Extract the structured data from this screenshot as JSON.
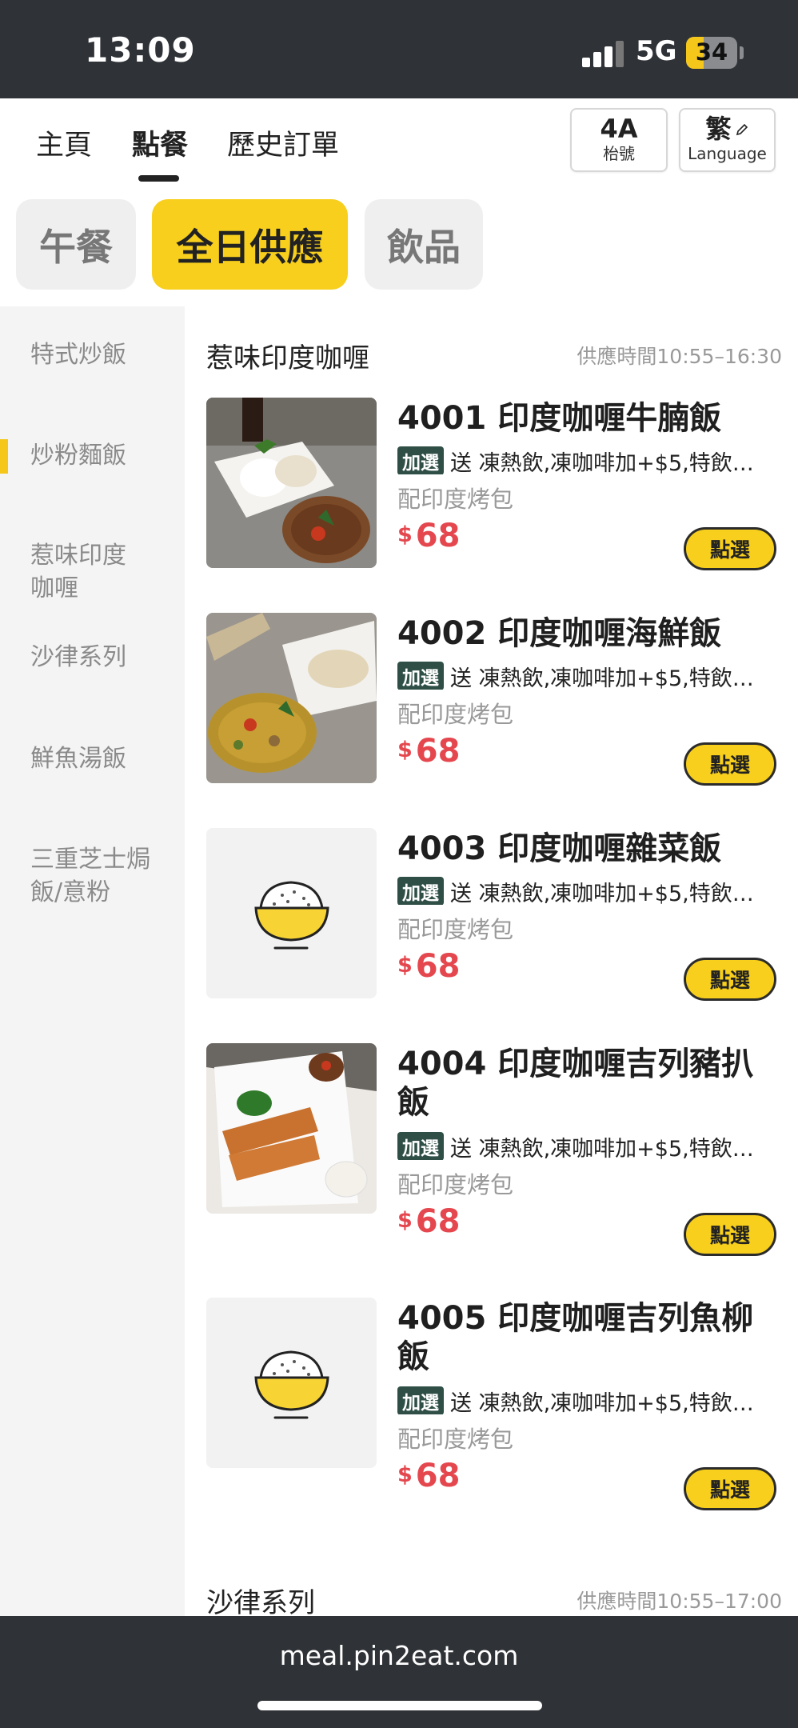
{
  "status": {
    "time": "13:09",
    "network": "5G",
    "battery": "34",
    "battery_level": 0.34
  },
  "nav": {
    "tabs": [
      {
        "label": "主頁"
      },
      {
        "label": "點餐"
      },
      {
        "label": "歷史訂單"
      }
    ],
    "active_tab": "點餐",
    "table_button": {
      "value": "4A",
      "caption": "枱號"
    },
    "lang_button": {
      "value": "繁",
      "caption": "Language"
    }
  },
  "categories": [
    {
      "label": "午餐"
    },
    {
      "label": "全日供應"
    },
    {
      "label": "飲品"
    }
  ],
  "active_category": "全日供應",
  "sidebar": {
    "items": [
      {
        "label": "特式炒飯"
      },
      {
        "label": "炒粉麵飯"
      },
      {
        "label": "惹味印度咖喱"
      },
      {
        "label": "沙律系列"
      },
      {
        "label": "鮮魚湯飯"
      },
      {
        "label": "三重芝士焗飯/意粉"
      }
    ]
  },
  "section": {
    "title": "惹味印度咖喱",
    "time": "供應時間10:55–16:30"
  },
  "items": [
    {
      "name": "4001 印度咖喱牛腩飯",
      "badge": "加選",
      "options": "送 凍熱飲,凍咖啡加+$5,特飲…",
      "sub": "配印度烤包",
      "currency": "$",
      "price": "68",
      "button": "點選",
      "photo": "beef-curry-photo"
    },
    {
      "name": "4002 印度咖喱海鮮飯",
      "badge": "加選",
      "options": "送 凍熱飲,凍咖啡加+$5,特飲…",
      "sub": "配印度烤包",
      "currency": "$",
      "price": "68",
      "button": "點選",
      "photo": "seafood-curry-photo"
    },
    {
      "name": "4003 印度咖喱雜菜飯",
      "badge": "加選",
      "options": "送 凍熱飲,凍咖啡加+$5,特飲…",
      "sub": "配印度烤包",
      "currency": "$",
      "price": "68",
      "button": "點選",
      "photo": "rice-bowl-icon"
    },
    {
      "name": "4004 印度咖喱吉列豬扒飯",
      "badge": "加選",
      "options": "送 凍熱飲,凍咖啡加+$5,特飲…",
      "sub": "配印度烤包",
      "currency": "$",
      "price": "68",
      "button": "點選",
      "photo": "pork-chop-curry-photo"
    },
    {
      "name": "4005 印度咖喱吉列魚柳飯",
      "badge": "加選",
      "options": "送 凍熱飲,凍咖啡加+$5,特飲…",
      "sub": "配印度烤包",
      "currency": "$",
      "price": "68",
      "button": "點選",
      "photo": "rice-bowl-icon"
    }
  ],
  "next_section": {
    "title": "沙律系列",
    "time": "供應時間10:55–17:00"
  },
  "browser": {
    "url": "meal.pin2eat.com"
  }
}
